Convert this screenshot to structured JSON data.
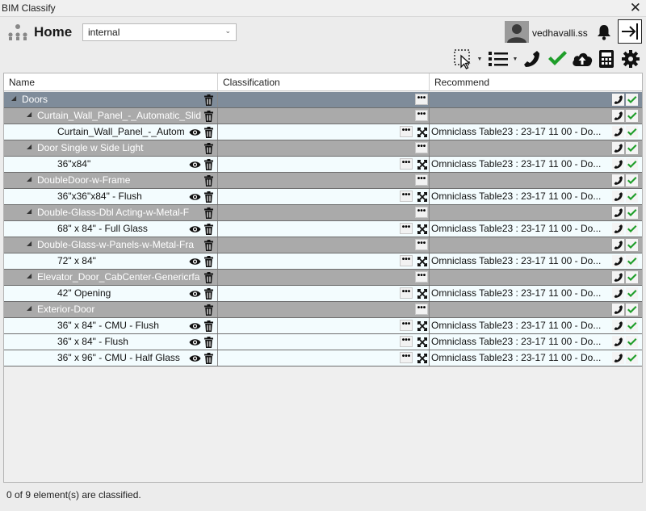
{
  "window": {
    "title": "BIM Classify",
    "close_glyph": "✕"
  },
  "header": {
    "home_label": "Home",
    "project_select": {
      "value": "internal"
    },
    "user": {
      "name": "vedhavalli.ss"
    }
  },
  "toolbar": {
    "icons": [
      "select-tool-icon",
      "list-view-icon",
      "phone-icon",
      "check-icon",
      "upload-icon",
      "calculator-icon",
      "gear-icon"
    ]
  },
  "grid": {
    "columns": [
      "Name",
      "Classification",
      "Recommend"
    ],
    "rows": [
      {
        "level": "category",
        "name": "Doors"
      },
      {
        "level": "family",
        "name": "Curtain_Wall_Panel_-_Automatic_Slid"
      },
      {
        "level": "type",
        "name": "Curtain_Wall_Panel_-_Autom",
        "recommend": "Omniclass Table23 : 23-17 11 00 - Do..."
      },
      {
        "level": "family",
        "name": "Door Single w Side Light"
      },
      {
        "level": "type",
        "name": "36\"x84\"",
        "recommend": "Omniclass Table23 : 23-17 11 00 - Do..."
      },
      {
        "level": "family",
        "name": "DoubleDoor-w-Frame"
      },
      {
        "level": "type",
        "name": "36\"x36\"x84\" - Flush",
        "recommend": "Omniclass Table23 : 23-17 11 00 - Do..."
      },
      {
        "level": "family",
        "name": "Double-Glass-Dbl Acting-w-Metal-F"
      },
      {
        "level": "type",
        "name": "68\" x 84\" - Full Glass",
        "recommend": "Omniclass Table23 : 23-17 11 00 - Do..."
      },
      {
        "level": "family",
        "name": "Double-Glass-w-Panels-w-Metal-Fra"
      },
      {
        "level": "type",
        "name": "72\" x 84\"",
        "recommend": "Omniclass Table23 : 23-17 11 00 - Do..."
      },
      {
        "level": "family",
        "name": "Elevator_Door_CabCenter-Genericrfa"
      },
      {
        "level": "type",
        "name": "42\" Opening",
        "recommend": "Omniclass Table23 : 23-17 11 00 - Do..."
      },
      {
        "level": "family",
        "name": "Exterior-Door"
      },
      {
        "level": "type",
        "name": "36\" x 84\" - CMU - Flush",
        "recommend": "Omniclass Table23 : 23-17 11 00 - Do..."
      },
      {
        "level": "type",
        "name": "36\" x 84\" - Flush",
        "recommend": "Omniclass Table23 : 23-17 11 00 - Do..."
      },
      {
        "level": "type",
        "name": "36\" x 96\" - CMU - Half Glass",
        "recommend": "Omniclass Table23 : 23-17 11 00 - Do..."
      }
    ]
  },
  "status_bar": {
    "text": "0 of 9 element(s) are classified."
  },
  "colors": {
    "category_row": "#7f8c9a",
    "family_row": "#aaaaaa",
    "type_row": "#f3fcfe",
    "check_green": "#1f9e2a"
  }
}
